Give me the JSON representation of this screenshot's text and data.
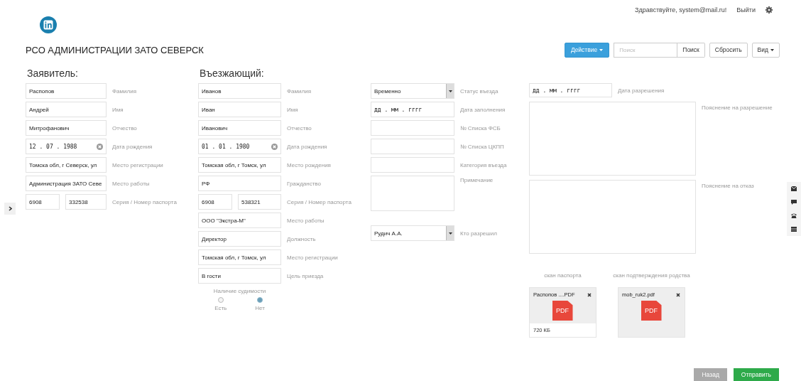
{
  "header": {
    "greeting": "Здравствуйте, system@mail.ru!",
    "logout": "Выйти",
    "title": "РСО АДМИНИСТРАЦИИ ЗАТО СЕВЕРСК"
  },
  "toolbar": {
    "action_button": "Действие",
    "search": {
      "placeholder": "Поиск"
    },
    "search_button": "Поиск",
    "reset_button": "Сбросить",
    "view_button": "Вид"
  },
  "applicant": {
    "heading": "Заявитель:",
    "fields": [
      {
        "kind": "text",
        "value": "Распопов",
        "label": "Фамилия"
      },
      {
        "kind": "text",
        "value": "Андрей",
        "label": "Имя"
      },
      {
        "kind": "text",
        "value": "Митрофанович",
        "label": "Отчество"
      },
      {
        "kind": "date",
        "value": "12 . 07 . 1988",
        "label": "Дата рождения"
      },
      {
        "kind": "text",
        "value": "Томска обл, г Северск, ул",
        "label": "Место регистрации"
      },
      {
        "kind": "text",
        "value": "Администрация ЗАТО Севе",
        "label": "Место работы"
      },
      {
        "kind": "pair",
        "value": "6908",
        "value2": "332538",
        "label": "Серия / Номер паспорта"
      }
    ]
  },
  "entrant": {
    "heading": "Въезжающий:",
    "fields": [
      {
        "kind": "text",
        "value": "Иванов",
        "label": "Фамилия"
      },
      {
        "kind": "text",
        "value": "Иван",
        "label": "Имя"
      },
      {
        "kind": "text",
        "value": "Иванович",
        "label": "Отчество"
      },
      {
        "kind": "date",
        "value": "01 . 01 . 1980",
        "label": "Дата рождения"
      },
      {
        "kind": "text",
        "value": "Томская обл, г Томск, ул",
        "label": "Место рождения"
      },
      {
        "kind": "text",
        "value": "РФ",
        "label": "Гражданство"
      },
      {
        "kind": "pair",
        "value": "6908",
        "value2": "538321",
        "label": "Серия / Номер паспорта"
      },
      {
        "kind": "text",
        "value": "ООО \"Экстра-М\"",
        "label": "Место работы"
      },
      {
        "kind": "text",
        "value": "Директор",
        "label": "Должность"
      },
      {
        "kind": "text",
        "value": "Томская обл, г Томск, ул",
        "label": "Место регистрации"
      },
      {
        "kind": "text",
        "value": "В гости",
        "label": "Цель приезда"
      }
    ],
    "criminal_record": {
      "label": "Наличие судимости",
      "options": [
        {
          "label": "Есть",
          "selected": false
        },
        {
          "label": "Нет",
          "selected": true
        }
      ]
    }
  },
  "entry": {
    "fields": [
      {
        "kind": "select",
        "value": "Временно",
        "label": "Статус въезда"
      },
      {
        "kind": "date",
        "placeholder": "дд . мм . гггг",
        "label": "Дата заполнения"
      },
      {
        "kind": "text",
        "label": "№ Списка ФСБ"
      },
      {
        "kind": "text",
        "label": "№ Списка ЦКПП"
      },
      {
        "kind": "text",
        "label": "Категория въезда"
      },
      {
        "kind": "textarea",
        "label": "Примечание"
      },
      {
        "kind": "select",
        "value": "Рудич А.А.",
        "label": "Кто разрешил"
      }
    ]
  },
  "permission": {
    "date": {
      "placeholder": "дд . мм . гггг",
      "label": "Дата разрешения"
    },
    "approval_note": {
      "label": "Пояснение на разрешение"
    },
    "refusal_note": {
      "label": "Пояснение на отказ"
    },
    "files": [
      {
        "caption": "скан паспорта",
        "name": "Распопов ....PDF",
        "badge": "PDF",
        "size": "720 КБ"
      },
      {
        "caption": "скан подтверждения родства",
        "name": "mob_ruk2.pdf",
        "badge": "PDF"
      }
    ]
  },
  "footer": {
    "back_button": {
      "label": "Назад",
      "disabled": true
    },
    "submit_button": {
      "label": "Отправить",
      "disabled": false
    }
  }
}
